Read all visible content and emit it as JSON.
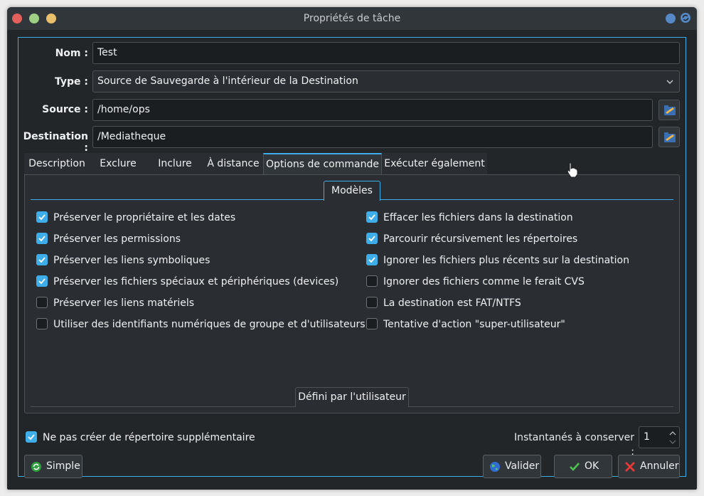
{
  "window": {
    "title": "Propriétés de tâche"
  },
  "form": {
    "name_label": "Nom :",
    "name_value": "Test",
    "type_label": "Type :",
    "type_value": "Source de Sauvegarde à l'intérieur de la Destination",
    "source_label": "Source :",
    "source_value": "/home/ops",
    "destination_label": "Destination :",
    "destination_value": "/Mediatheque"
  },
  "tabs": [
    {
      "label": "Description"
    },
    {
      "label": "Exclure"
    },
    {
      "label": "Inclure"
    },
    {
      "label": "À distance"
    },
    {
      "label": "Options de commande"
    },
    {
      "label": "Exécuter également"
    }
  ],
  "active_tab": "Options de commande",
  "options": {
    "models_tab": "Modèles",
    "user_defined_tab": "Défini par l'utilisateur",
    "left": [
      {
        "label": "Préserver le propriétaire et les dates",
        "checked": true
      },
      {
        "label": "Préserver les permissions",
        "checked": true
      },
      {
        "label": "Préserver les liens symboliques",
        "checked": true
      },
      {
        "label": "Préserver les fichiers spéciaux et périphériques (devices)",
        "checked": true
      },
      {
        "label": "Préserver les liens matériels",
        "checked": false
      },
      {
        "label": "Utiliser des identifiants numériques de groupe et d'utilisateurs",
        "checked": false
      }
    ],
    "right": [
      {
        "label": "Effacer les fichiers dans la destination",
        "checked": true
      },
      {
        "label": "Parcourir récursivement les répertoires",
        "checked": true
      },
      {
        "label": "Ignorer les fichiers plus récents sur la destination",
        "checked": true
      },
      {
        "label": "Ignorer des fichiers comme le ferait CVS",
        "checked": false
      },
      {
        "label": "La destination est FAT/NTFS",
        "checked": false
      },
      {
        "label": "Tentative d'action \"super-utilisateur\"",
        "checked": false
      }
    ]
  },
  "footer": {
    "no_extra_dir_label": "Ne pas créer de répertoire supplémentaire",
    "no_extra_dir_checked": true,
    "snapshots_label": "Instantanés à conserver :",
    "snapshots_value": "1",
    "simple_button": "Simple",
    "validate_button": "Valider",
    "ok_button": "OK",
    "cancel_button": "Annuler"
  },
  "colors": {
    "accent": "#3daee9",
    "background": "#232629",
    "panel": "#2a2e32"
  }
}
